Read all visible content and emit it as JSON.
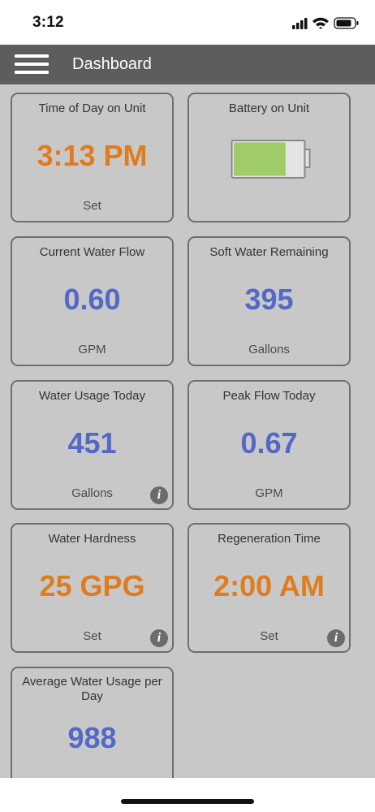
{
  "status_bar": {
    "time": "3:12",
    "icons": [
      "cellular-signal-icon",
      "wifi-icon",
      "battery-icon"
    ]
  },
  "navbar": {
    "title": "Dashboard",
    "menu_icon": "hamburger-menu-icon"
  },
  "colors": {
    "navbar": "#5d5d5d",
    "background": "#c8c8c8",
    "value_orange": "#e07c1d",
    "value_blue": "#5468c8",
    "battery_fill": "#a0cc68"
  },
  "tiles": [
    {
      "title": "Time of Day on Unit",
      "value": "3:13 PM",
      "sub": "Set",
      "value_color": "orange",
      "info": false
    },
    {
      "title": "Battery on Unit",
      "battery_level": 0.75,
      "info": false
    },
    {
      "title": "Current Water Flow",
      "value": "0.60",
      "sub": "GPM",
      "value_color": "blue",
      "info": false
    },
    {
      "title": "Soft Water Remaining",
      "value": "395",
      "sub": "Gallons",
      "value_color": "blue",
      "info": false
    },
    {
      "title": "Water Usage Today",
      "value": "451",
      "sub": "Gallons",
      "value_color": "blue",
      "info": true
    },
    {
      "title": "Peak Flow Today",
      "value": "0.67",
      "sub": "GPM",
      "value_color": "blue",
      "info": false
    },
    {
      "title": "Water Hardness",
      "value": "25 GPG",
      "sub": "Set",
      "value_color": "orange",
      "info": true
    },
    {
      "title": "Regeneration Time",
      "value": "2:00 AM",
      "sub": "Set",
      "value_color": "orange",
      "info": true
    },
    {
      "title": "Average Water Usage per Day",
      "value": "988",
      "value_color": "blue",
      "info": false
    }
  ],
  "info_icon_glyph": "i"
}
